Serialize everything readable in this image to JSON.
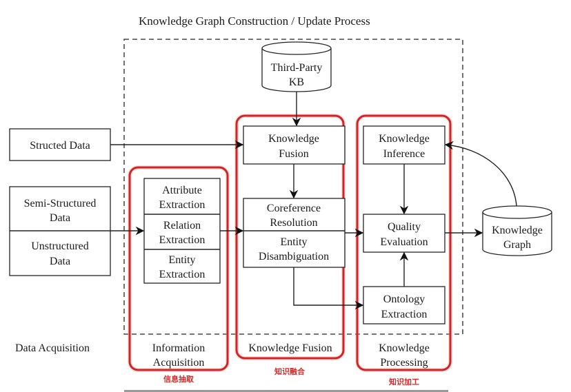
{
  "diagram": {
    "title": "Knowledge Graph Construction / Update Process",
    "colors": {
      "highlight": "#d32424",
      "stroke": "#222222",
      "chinese_label": "#d42a2a"
    },
    "sources": {
      "structured": "Structed Data",
      "semi_structured": [
        "Semi-Structured",
        "Data"
      ],
      "unstructured": [
        "Unstructured",
        "Data"
      ]
    },
    "third_party_kb": [
      "Third-Party",
      "KB"
    ],
    "information_acquisition": {
      "attribute": [
        "Attribute",
        "Extraction"
      ],
      "relation": [
        "Relation",
        "Extraction"
      ],
      "entity": [
        "Entity",
        "Extraction"
      ]
    },
    "knowledge_fusion": {
      "fusion": [
        "Knowledge",
        "Fusion"
      ],
      "coreference": [
        "Coreference",
        "Resolution"
      ],
      "disambiguation": [
        "Entity",
        "Disambiguation"
      ]
    },
    "knowledge_processing": {
      "inference": [
        "Knowledge",
        "Inference"
      ],
      "quality": [
        "Quality",
        "Evaluation"
      ],
      "ontology": [
        "Ontology",
        "Extraction"
      ]
    },
    "knowledge_graph": [
      "Knowledge",
      "Graph"
    ],
    "stage_labels": {
      "data_acquisition": "Data Acquisition",
      "information_acquisition": [
        "Information",
        "Acquisition"
      ],
      "knowledge_fusion": "Knowledge Fusion",
      "knowledge_processing": [
        "Knowledge",
        "Processing"
      ]
    },
    "chinese_labels": {
      "information_extraction": "信息抽取",
      "knowledge_fusion": "知识融合",
      "knowledge_processing": "知识加工"
    }
  }
}
